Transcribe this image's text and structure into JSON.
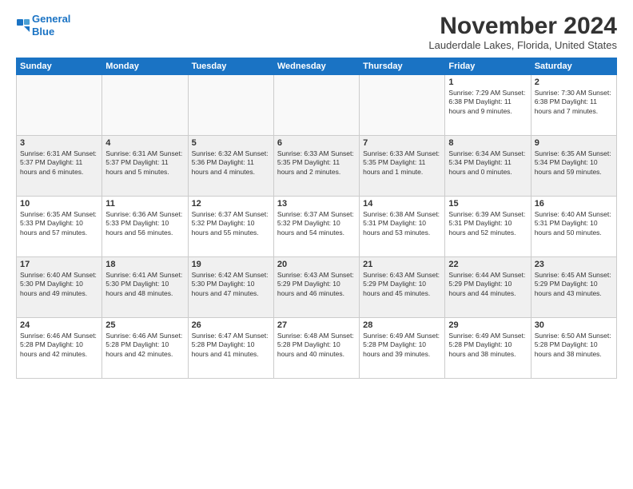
{
  "logo": {
    "line1": "General",
    "line2": "Blue"
  },
  "title": "November 2024",
  "subtitle": "Lauderdale Lakes, Florida, United States",
  "weekdays": [
    "Sunday",
    "Monday",
    "Tuesday",
    "Wednesday",
    "Thursday",
    "Friday",
    "Saturday"
  ],
  "weeks": [
    [
      {
        "day": "",
        "info": ""
      },
      {
        "day": "",
        "info": ""
      },
      {
        "day": "",
        "info": ""
      },
      {
        "day": "",
        "info": ""
      },
      {
        "day": "",
        "info": ""
      },
      {
        "day": "1",
        "info": "Sunrise: 7:29 AM\nSunset: 6:38 PM\nDaylight: 11 hours\nand 9 minutes."
      },
      {
        "day": "2",
        "info": "Sunrise: 7:30 AM\nSunset: 6:38 PM\nDaylight: 11 hours\nand 7 minutes."
      }
    ],
    [
      {
        "day": "3",
        "info": "Sunrise: 6:31 AM\nSunset: 5:37 PM\nDaylight: 11 hours\nand 6 minutes."
      },
      {
        "day": "4",
        "info": "Sunrise: 6:31 AM\nSunset: 5:37 PM\nDaylight: 11 hours\nand 5 minutes."
      },
      {
        "day": "5",
        "info": "Sunrise: 6:32 AM\nSunset: 5:36 PM\nDaylight: 11 hours\nand 4 minutes."
      },
      {
        "day": "6",
        "info": "Sunrise: 6:33 AM\nSunset: 5:35 PM\nDaylight: 11 hours\nand 2 minutes."
      },
      {
        "day": "7",
        "info": "Sunrise: 6:33 AM\nSunset: 5:35 PM\nDaylight: 11 hours\nand 1 minute."
      },
      {
        "day": "8",
        "info": "Sunrise: 6:34 AM\nSunset: 5:34 PM\nDaylight: 11 hours\nand 0 minutes."
      },
      {
        "day": "9",
        "info": "Sunrise: 6:35 AM\nSunset: 5:34 PM\nDaylight: 10 hours\nand 59 minutes."
      }
    ],
    [
      {
        "day": "10",
        "info": "Sunrise: 6:35 AM\nSunset: 5:33 PM\nDaylight: 10 hours\nand 57 minutes."
      },
      {
        "day": "11",
        "info": "Sunrise: 6:36 AM\nSunset: 5:33 PM\nDaylight: 10 hours\nand 56 minutes."
      },
      {
        "day": "12",
        "info": "Sunrise: 6:37 AM\nSunset: 5:32 PM\nDaylight: 10 hours\nand 55 minutes."
      },
      {
        "day": "13",
        "info": "Sunrise: 6:37 AM\nSunset: 5:32 PM\nDaylight: 10 hours\nand 54 minutes."
      },
      {
        "day": "14",
        "info": "Sunrise: 6:38 AM\nSunset: 5:31 PM\nDaylight: 10 hours\nand 53 minutes."
      },
      {
        "day": "15",
        "info": "Sunrise: 6:39 AM\nSunset: 5:31 PM\nDaylight: 10 hours\nand 52 minutes."
      },
      {
        "day": "16",
        "info": "Sunrise: 6:40 AM\nSunset: 5:31 PM\nDaylight: 10 hours\nand 50 minutes."
      }
    ],
    [
      {
        "day": "17",
        "info": "Sunrise: 6:40 AM\nSunset: 5:30 PM\nDaylight: 10 hours\nand 49 minutes."
      },
      {
        "day": "18",
        "info": "Sunrise: 6:41 AM\nSunset: 5:30 PM\nDaylight: 10 hours\nand 48 minutes."
      },
      {
        "day": "19",
        "info": "Sunrise: 6:42 AM\nSunset: 5:30 PM\nDaylight: 10 hours\nand 47 minutes."
      },
      {
        "day": "20",
        "info": "Sunrise: 6:43 AM\nSunset: 5:29 PM\nDaylight: 10 hours\nand 46 minutes."
      },
      {
        "day": "21",
        "info": "Sunrise: 6:43 AM\nSunset: 5:29 PM\nDaylight: 10 hours\nand 45 minutes."
      },
      {
        "day": "22",
        "info": "Sunrise: 6:44 AM\nSunset: 5:29 PM\nDaylight: 10 hours\nand 44 minutes."
      },
      {
        "day": "23",
        "info": "Sunrise: 6:45 AM\nSunset: 5:29 PM\nDaylight: 10 hours\nand 43 minutes."
      }
    ],
    [
      {
        "day": "24",
        "info": "Sunrise: 6:46 AM\nSunset: 5:28 PM\nDaylight: 10 hours\nand 42 minutes."
      },
      {
        "day": "25",
        "info": "Sunrise: 6:46 AM\nSunset: 5:28 PM\nDaylight: 10 hours\nand 42 minutes."
      },
      {
        "day": "26",
        "info": "Sunrise: 6:47 AM\nSunset: 5:28 PM\nDaylight: 10 hours\nand 41 minutes."
      },
      {
        "day": "27",
        "info": "Sunrise: 6:48 AM\nSunset: 5:28 PM\nDaylight: 10 hours\nand 40 minutes."
      },
      {
        "day": "28",
        "info": "Sunrise: 6:49 AM\nSunset: 5:28 PM\nDaylight: 10 hours\nand 39 minutes."
      },
      {
        "day": "29",
        "info": "Sunrise: 6:49 AM\nSunset: 5:28 PM\nDaylight: 10 hours\nand 38 minutes."
      },
      {
        "day": "30",
        "info": "Sunrise: 6:50 AM\nSunset: 5:28 PM\nDaylight: 10 hours\nand 38 minutes."
      }
    ]
  ]
}
